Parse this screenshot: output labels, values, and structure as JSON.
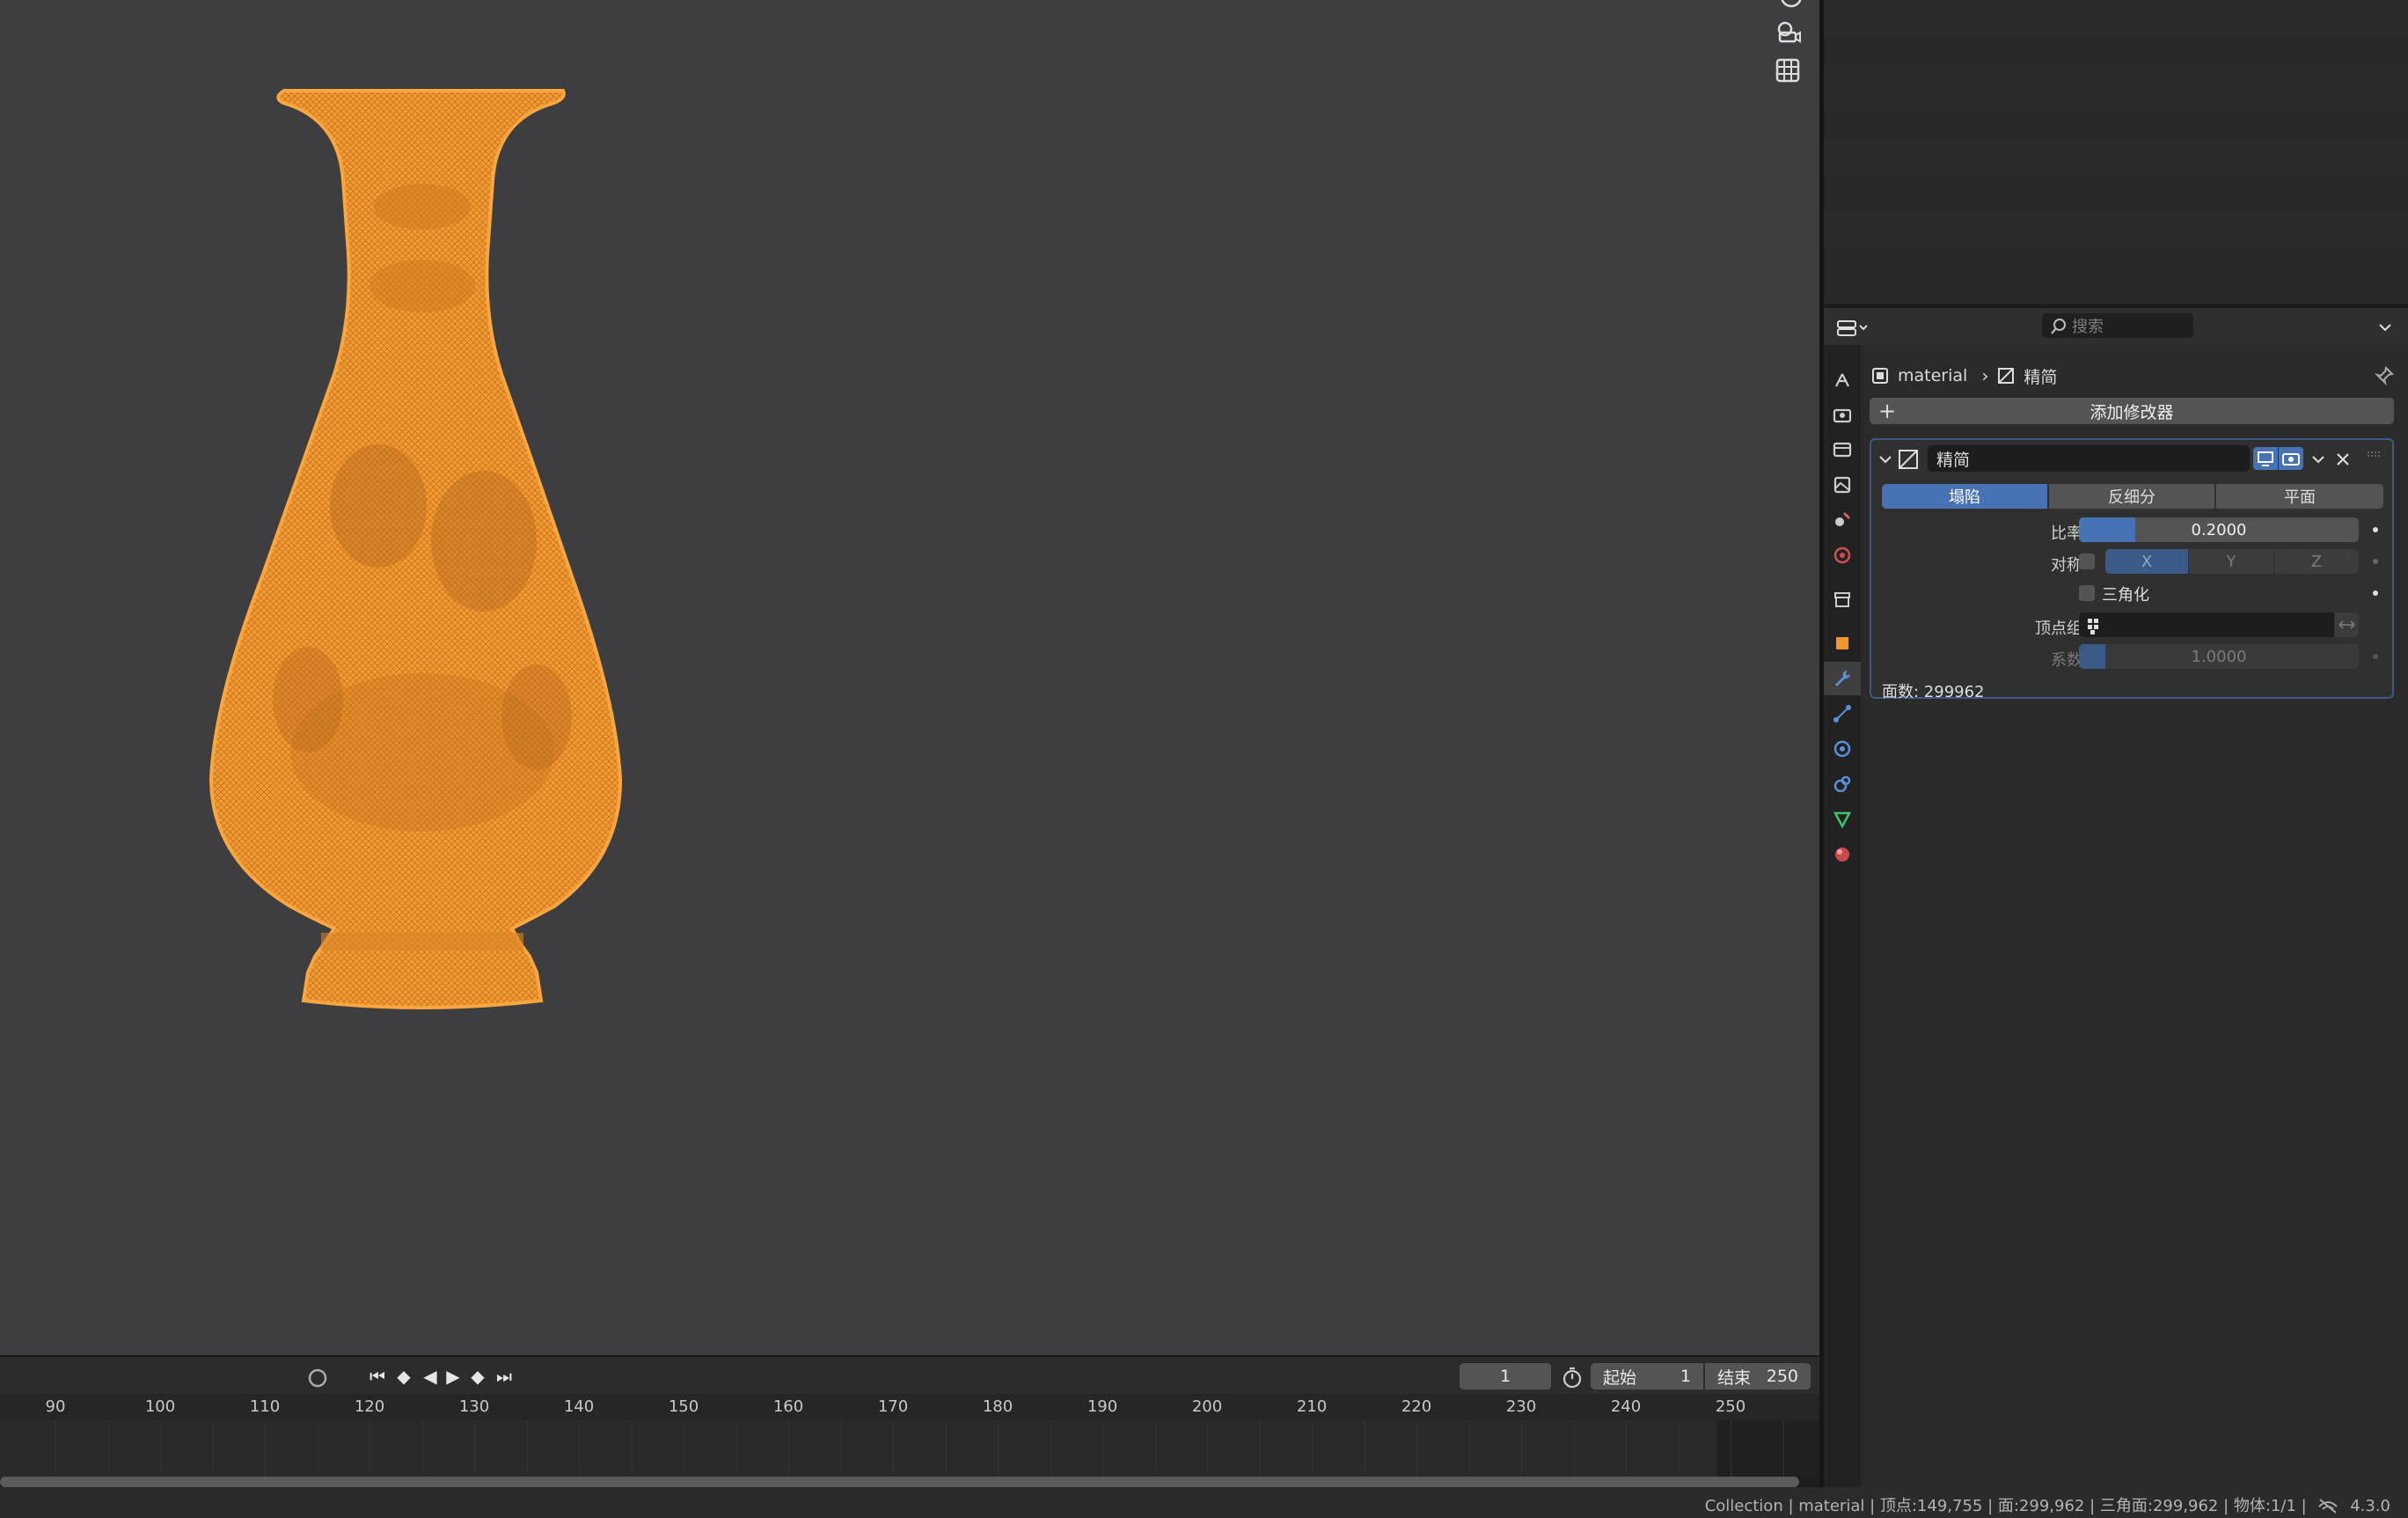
{
  "timeline": {
    "ticks": [
      "90",
      "100",
      "110",
      "120",
      "130",
      "140",
      "150",
      "160",
      "170",
      "180",
      "190",
      "200",
      "210",
      "220",
      "230",
      "240",
      "250"
    ],
    "current_frame": "1",
    "start_label": "起始",
    "start_value": "1",
    "end_label": "结束",
    "end_value": "250"
  },
  "properties": {
    "search_placeholder": "搜索",
    "breadcrumb": {
      "object": "material",
      "modifier": "精简"
    },
    "add_modifier_label": "添加修改器",
    "modifier": {
      "name": "精简",
      "modes": [
        "塌陷",
        "反细分",
        "平面"
      ],
      "active_mode": "塌陷",
      "ratio_label": "比率",
      "ratio_value": "0.2000",
      "ratio_fraction": 0.2,
      "symmetry_label": "对称",
      "axes": [
        "X",
        "Y",
        "Z"
      ],
      "triangulate_label": "三角化",
      "vertex_group_label": "顶点组",
      "factor_label": "系数",
      "factor_value": "1.0000",
      "face_count": "面数: 299962"
    }
  },
  "statusbar": {
    "text": "Collection | material | 顶点:149,755 | 面:299,962 | 三角面:299,962 | 物体:1/1 |",
    "version": "4.3.0"
  },
  "colors": {
    "viewport_bg": "#3e3e40",
    "selection_orange": "#f0962f",
    "accent_blue": "#4772b3"
  }
}
